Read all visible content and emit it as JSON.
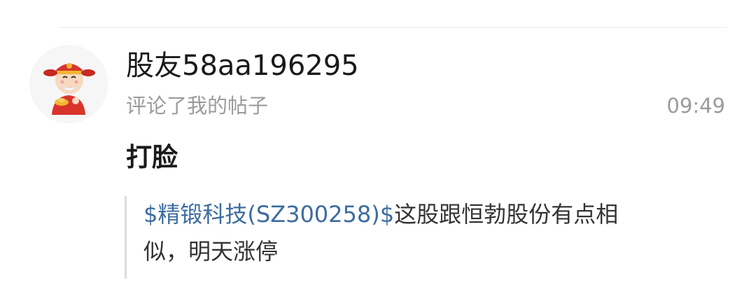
{
  "notification": {
    "username": "股友58aa196295",
    "action": "评论了我的帖子",
    "time": "09:49",
    "comment": "打脸",
    "quote": {
      "stock_link": "$精锻科技(SZ300258)$",
      "text_line1_rest": "这股跟恒勃股份有点相",
      "text_line2": "似，明天涨停"
    }
  },
  "colors": {
    "link": "#3c6c9f",
    "muted": "#9b9b9b",
    "primary_text": "#1a1a1a"
  },
  "avatar": {
    "icon": "fortune-god-avatar-icon"
  }
}
